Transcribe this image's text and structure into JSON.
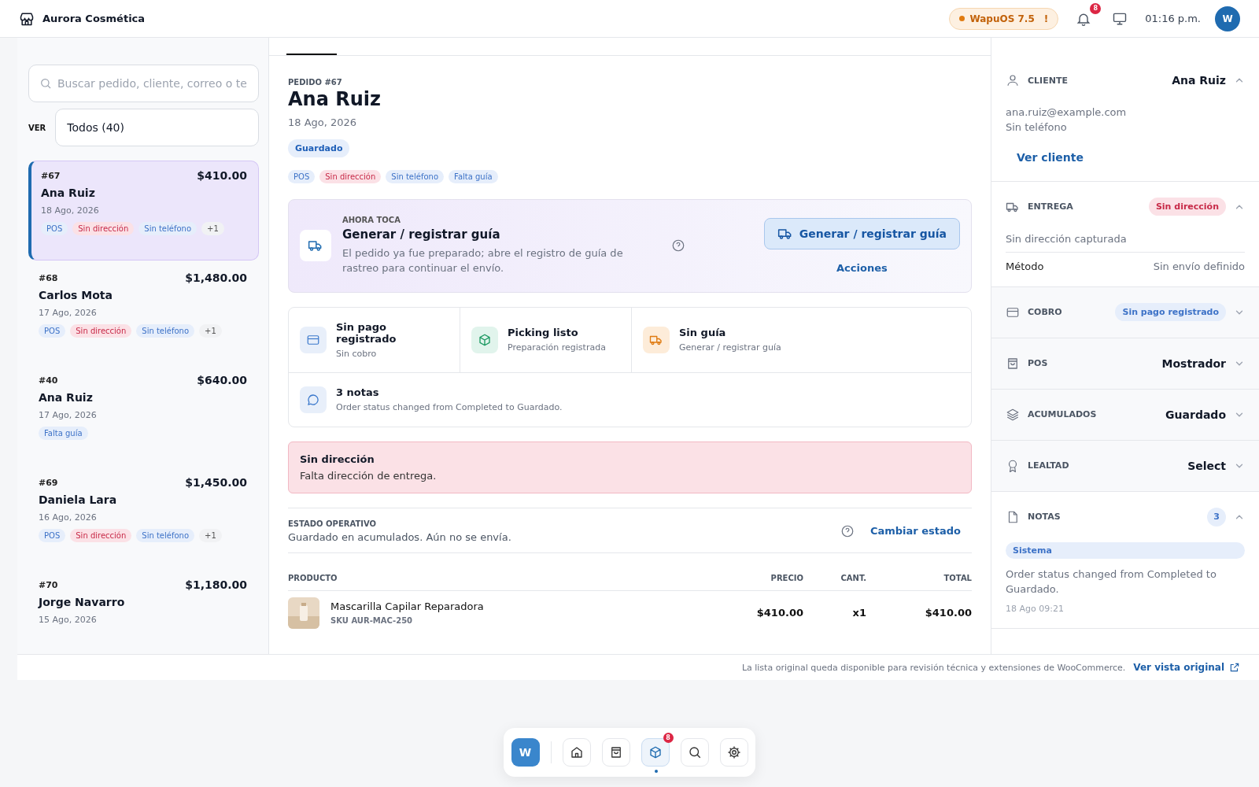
{
  "header": {
    "store": "Aurora Cosmética",
    "version": "WapuOS 7.5",
    "version_alert": "!",
    "notifications": "8",
    "time": "01:16 p.m.",
    "avatar": "W"
  },
  "list": {
    "search_placeholder": "Buscar pedido, cliente, correo o te",
    "filter_label": "VER",
    "filter_value": "Todos (40)",
    "orders": [
      {
        "number": "#67",
        "total": "$410.00",
        "customer": "Ana Ruiz",
        "date": "18 Ago, 2026",
        "selected": true,
        "tags": [
          {
            "text": "POS",
            "kind": "info"
          },
          {
            "text": "Sin dirección",
            "kind": "danger"
          },
          {
            "text": "Sin teléfono",
            "kind": "info"
          },
          {
            "text": "+1",
            "kind": "count"
          }
        ]
      },
      {
        "number": "#68",
        "total": "$1,480.00",
        "customer": "Carlos Mota",
        "date": "17 Ago, 2026",
        "selected": false,
        "tags": [
          {
            "text": "POS",
            "kind": "info"
          },
          {
            "text": "Sin dirección",
            "kind": "danger"
          },
          {
            "text": "Sin teléfono",
            "kind": "info"
          },
          {
            "text": "+1",
            "kind": "count"
          }
        ]
      },
      {
        "number": "#40",
        "total": "$640.00",
        "customer": "Ana Ruiz",
        "date": "17 Ago, 2026",
        "selected": false,
        "tags": [
          {
            "text": "Falta guía",
            "kind": "info"
          }
        ]
      },
      {
        "number": "#69",
        "total": "$1,450.00",
        "customer": "Daniela Lara",
        "date": "16 Ago, 2026",
        "selected": false,
        "tags": [
          {
            "text": "POS",
            "kind": "info"
          },
          {
            "text": "Sin dirección",
            "kind": "danger"
          },
          {
            "text": "Sin teléfono",
            "kind": "info"
          },
          {
            "text": "+1",
            "kind": "count"
          }
        ]
      },
      {
        "number": "#70",
        "total": "$1,180.00",
        "customer": "Jorge Navarro",
        "date": "15 Ago, 2026",
        "selected": false
      }
    ]
  },
  "order": {
    "eyebrow": "PEDIDO #67",
    "customer": "Ana Ruiz",
    "date": "18 Ago, 2026",
    "status": "Guardado",
    "tags": [
      {
        "text": "POS",
        "kind": "info"
      },
      {
        "text": "Sin dirección",
        "kind": "danger"
      },
      {
        "text": "Sin teléfono",
        "kind": "info"
      },
      {
        "text": "Falta guía",
        "kind": "info"
      }
    ],
    "next": {
      "eyebrow": "AHORA TOCA",
      "title": "Generar / registrar guía",
      "description": "El pedido ya fue preparado; abre el registro de guía de rastreo para continuar el envío.",
      "primary": "Generar / registrar guía",
      "secondary": "Acciones"
    },
    "checks": [
      {
        "kind": "payment",
        "title": "Sin pago registrado",
        "subtitle": "Sin cobro"
      },
      {
        "kind": "picking",
        "title": "Picking listo",
        "subtitle": "Preparación registrada"
      },
      {
        "kind": "shipping",
        "title": "Sin guía",
        "subtitle": "Generar / registrar guía"
      }
    ],
    "notes": {
      "title": "3 notas",
      "subtitle": "Order status changed from Completed to Guardado."
    },
    "alert": {
      "title": "Sin dirección",
      "message": "Falta dirección de entrega."
    },
    "state": {
      "label": "ESTADO OPERATIVO",
      "text": "Guardado en acumulados. Aún no se envía.",
      "action": "Cambiar estado"
    },
    "table": {
      "columns": [
        "PRODUCTO",
        "PRECIO",
        "CANT.",
        "TOTAL"
      ],
      "rows": [
        {
          "name": "Mascarilla Capilar Reparadora",
          "sku": "SKU AUR-MAC-250",
          "price": "$410.00",
          "qty": "x1",
          "total": "$410.00"
        }
      ]
    }
  },
  "sidebar": [
    {
      "label": "CLIENTE",
      "value": "Ana Ruiz",
      "kind": "text",
      "expanded": true,
      "lines": [
        "ana.ruiz@example.com",
        "Sin teléfono"
      ],
      "link": "Ver cliente"
    },
    {
      "label": "ENTREGA",
      "value": "Sin dirección",
      "kind": "danger",
      "expanded": true,
      "lines": [
        "Sin dirección capturada"
      ],
      "rows": [
        {
          "label": "Método",
          "value": "Sin envío definido"
        }
      ]
    },
    {
      "label": "COBRO",
      "value": "Sin pago registrado",
      "kind": "info",
      "expanded": false
    },
    {
      "label": "POS",
      "value": "Mostrador",
      "kind": "text",
      "expanded": false
    },
    {
      "label": "ACUMULADOS",
      "value": "Guardado",
      "kind": "text",
      "expanded": false
    },
    {
      "label": "LEALTAD",
      "value": "Select",
      "kind": "text",
      "expanded": false
    },
    {
      "label": "NOTAS",
      "value": "3",
      "kind": "count",
      "expanded": true,
      "note": {
        "source": "Sistema",
        "text": "Order status changed from Completed to Guardado.",
        "time": "18 Ago 09:21"
      }
    }
  ],
  "footer": {
    "text": "La lista original queda disponible para revisión técnica y extensiones de WooCommerce.",
    "link": "Ver vista original"
  },
  "dock": [
    {
      "kind": "logo",
      "label": "W",
      "selected": false
    },
    {
      "kind": "home",
      "selected": false
    },
    {
      "kind": "bag",
      "selected": false
    },
    {
      "kind": "box",
      "selected": true,
      "badge": "8"
    },
    {
      "kind": "search",
      "selected": false
    },
    {
      "kind": "settings",
      "selected": false
    }
  ]
}
